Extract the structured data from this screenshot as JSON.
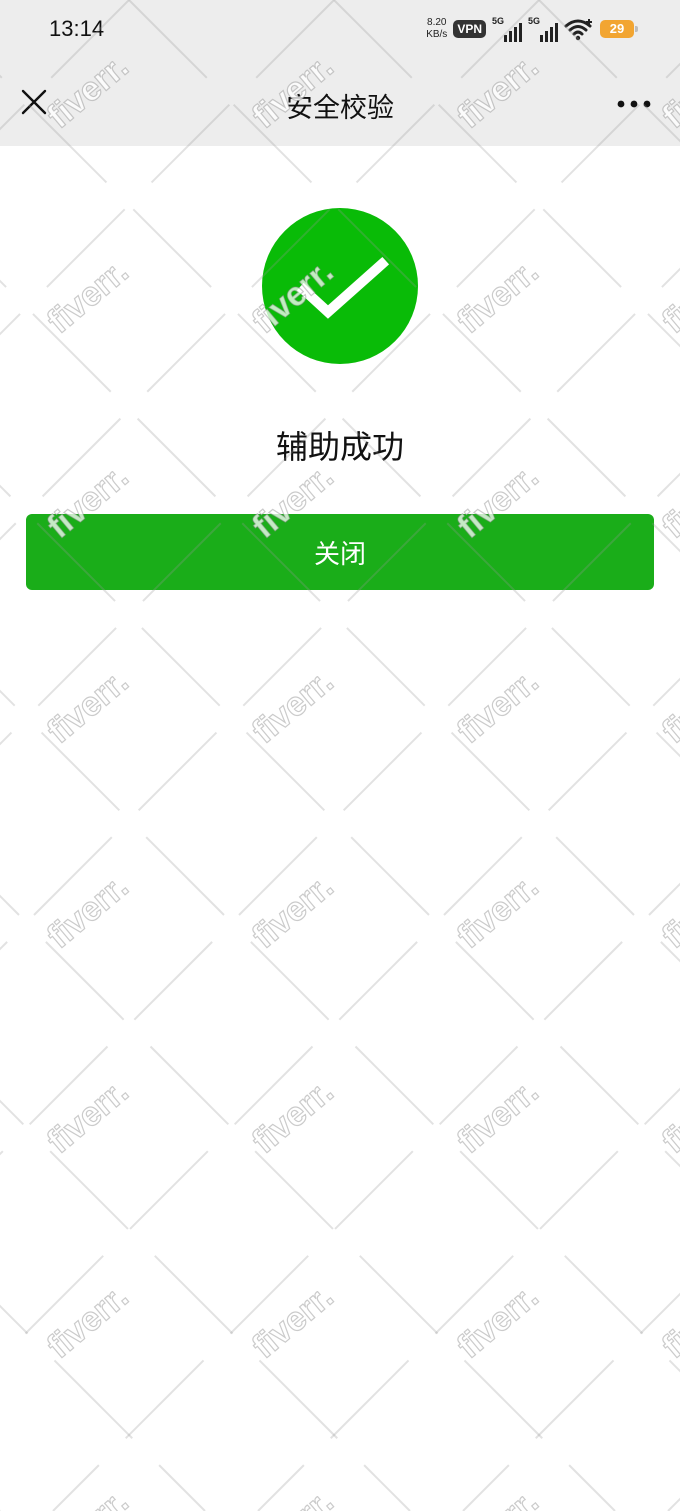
{
  "status_bar": {
    "time": "13:14",
    "net_speed_value": "8.20",
    "net_speed_unit": "KB/s",
    "vpn_label": "VPN",
    "signal1_label": "5G",
    "signal2_label": "5G",
    "battery_level": "29",
    "icons": [
      "signal-icon",
      "signal-icon",
      "wifi-icon",
      "battery-icon"
    ]
  },
  "nav": {
    "title": "安全校验",
    "icons": [
      "close-icon",
      "more-icon"
    ]
  },
  "result": {
    "icon": "success-check-icon",
    "message": "辅助成功",
    "accent_color": "#09bb07"
  },
  "actions": {
    "close_label": "关闭",
    "button_color": "#1aad19"
  },
  "watermark": {
    "text": "fiverr."
  }
}
